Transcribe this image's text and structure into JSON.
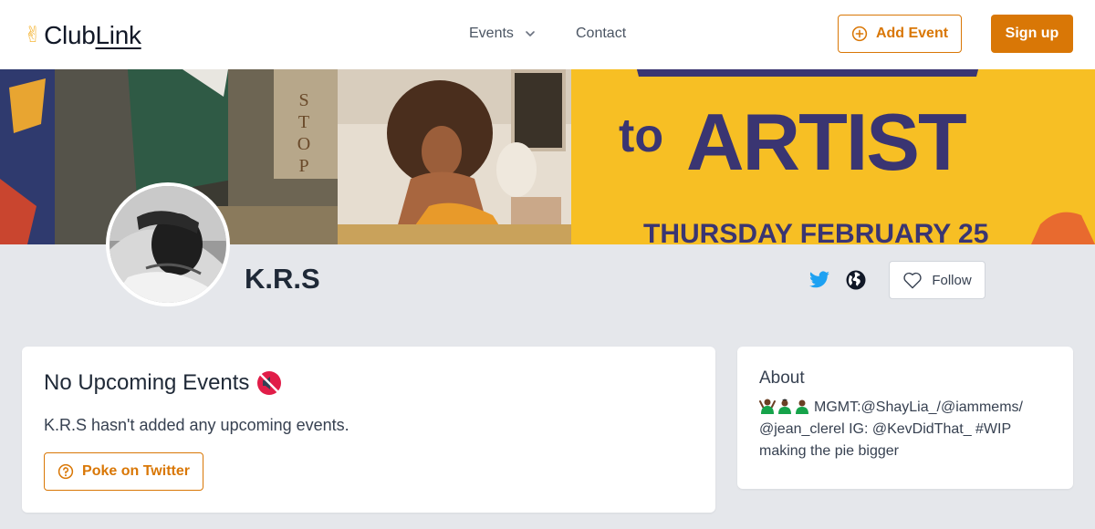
{
  "header": {
    "logo_prefix": "Club",
    "logo_underlined": "Link",
    "nav_events": "Events",
    "nav_contact": "Contact",
    "add_event_label": "Add Event",
    "signup_label": "Sign up"
  },
  "banner": {
    "poster_word_small": "to",
    "poster_word_large": "ARTIST",
    "poster_date": "THURSDAY FEBRUARY 25",
    "sign_text": "STOP"
  },
  "profile": {
    "name": "K.R.S",
    "follow_label": "Follow"
  },
  "events": {
    "title": "No Upcoming Events",
    "subtitle": "K.R.S hasn't added any upcoming events.",
    "poke_label": "Poke on Twitter"
  },
  "about": {
    "title": "About",
    "bio": "MGMT:@ShayLia_/@iammems/ @jean_clerel IG: @KevDidThat_ #WIP making the pie bigger"
  },
  "colors": {
    "accent": "#d97706",
    "twitter": "#1da1f2",
    "page_bg": "#e5e7eb",
    "poster_yellow": "#f7bf24",
    "poster_navy": "#3a3572"
  }
}
